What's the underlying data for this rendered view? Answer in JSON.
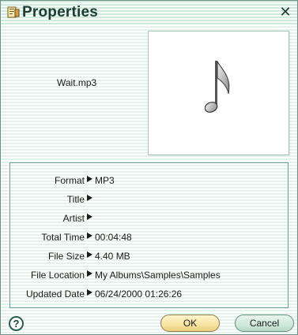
{
  "window": {
    "title": "Properties",
    "close_glyph": "✕"
  },
  "header": {
    "filename": "Wait.mp3",
    "art_icon": "music-note-icon"
  },
  "properties": [
    {
      "label": "Format",
      "value": "MP3"
    },
    {
      "label": "Title",
      "value": ""
    },
    {
      "label": "Artist",
      "value": ""
    },
    {
      "label": "Total Time",
      "value": "00:04:48"
    },
    {
      "label": "File Size",
      "value": "4.40 MB"
    },
    {
      "label": "File Location",
      "value": "My Albums\\Samples\\Samples"
    },
    {
      "label": "Updated Date",
      "value": "06/24/2000 01:26:26"
    }
  ],
  "buttons": {
    "help": "?",
    "ok": "OK",
    "cancel": "Cancel"
  },
  "colors": {
    "stripe": "#e3f3ea",
    "ok_button": "#f6e3a0",
    "cancel_button": "#cfe9da",
    "panel_border": "#6c9b9a"
  }
}
